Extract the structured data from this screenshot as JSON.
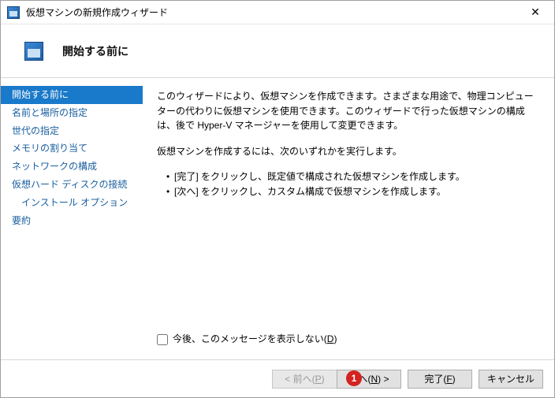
{
  "window": {
    "title": "仮想マシンの新規作成ウィザード"
  },
  "header": {
    "heading": "開始する前に"
  },
  "sidebar": {
    "items": [
      {
        "label": "開始する前に",
        "selected": true,
        "indent": false
      },
      {
        "label": "名前と場所の指定",
        "selected": false,
        "indent": false
      },
      {
        "label": "世代の指定",
        "selected": false,
        "indent": false
      },
      {
        "label": "メモリの割り当て",
        "selected": false,
        "indent": false
      },
      {
        "label": "ネットワークの構成",
        "selected": false,
        "indent": false
      },
      {
        "label": "仮想ハード ディスクの接続",
        "selected": false,
        "indent": false
      },
      {
        "label": "インストール オプション",
        "selected": false,
        "indent": true
      },
      {
        "label": "要約",
        "selected": false,
        "indent": false
      }
    ]
  },
  "content": {
    "intro": "このウィザードにより、仮想マシンを作成できます。さまざまな用途で、物理コンピューターの代わりに仮想マシンを使用できます。このウィザードで行った仮想マシンの構成は、後で Hyper-V マネージャーを使用して変更できます。",
    "instruction": "仮想マシンを作成するには、次のいずれかを実行します。",
    "bullets": [
      "[完了] をクリックし、既定値で構成された仮想マシンを作成します。",
      "[次へ] をクリックし、カスタム構成で仮想マシンを作成します。"
    ],
    "checkbox": {
      "label_prefix": "今後、このメッセージを表示しない(",
      "mnemonic": "D",
      "label_suffix": ")",
      "checked": false
    }
  },
  "footer": {
    "prev": {
      "text": "< 前へ(",
      "mnemonic": "P",
      "suffix": ")",
      "enabled": false
    },
    "next": {
      "text": "次へ(",
      "mnemonic": "N",
      "suffix": ") >",
      "enabled": true
    },
    "finish": {
      "text": "完了(",
      "mnemonic": "F",
      "suffix": ")",
      "enabled": true
    },
    "cancel": {
      "text": "キャンセル",
      "enabled": true
    }
  },
  "annotations": {
    "marker1": "1"
  }
}
